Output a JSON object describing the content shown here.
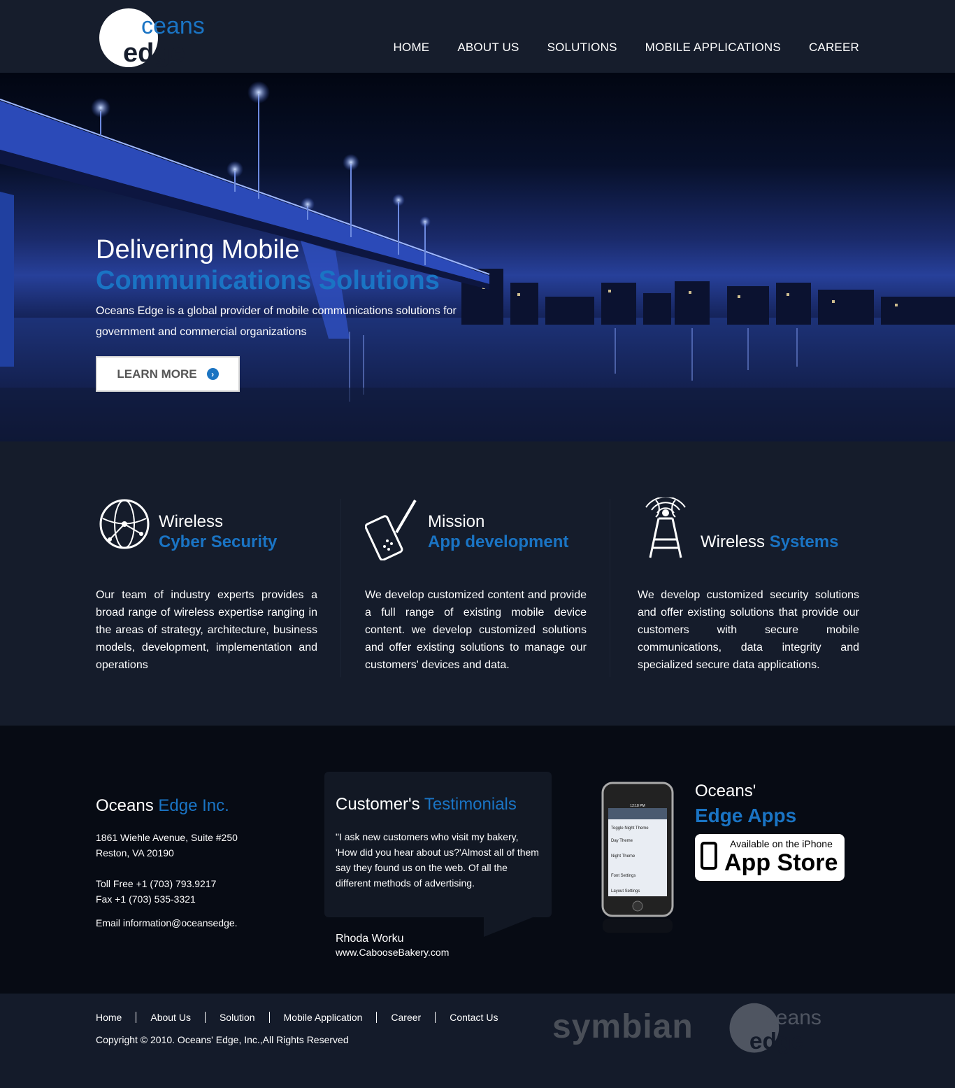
{
  "header": {
    "logo_text_top": "ceans",
    "logo_text_bottom": "edge",
    "nav": [
      "HOME",
      "ABOUT US",
      "SOLUTIONS",
      "MOBILE APPLICATIONS",
      "CAREER"
    ]
  },
  "hero": {
    "title_line1": "Delivering Mobile",
    "title_line2": "Communications Solutions",
    "description": "Oceans Edge is a global provider of mobile communications solutions for government and commercial organizations",
    "button_label": "LEARN MORE",
    "button_icon": "chevron-right-circle-icon"
  },
  "features": [
    {
      "title_white": "Wireless",
      "title_blue": "Cyber Security",
      "icon": "globe-network-icon",
      "text": "Our team of industry experts provides a broad range of wireless expertise ranging in the areas of strategy, architecture, business models, development, implementation and operations"
    },
    {
      "title_white": "Mission",
      "title_blue": "App development",
      "icon": "phone-pencil-icon",
      "text": "We develop customized content and provide a full range of existing mobile device content. we develop customized solutions and offer existing solutions to manage our customers' devices and data."
    },
    {
      "title_white": "Wireless",
      "title_blue": "Systems",
      "icon": "antenna-tower-icon",
      "text": "We develop customized security solutions and offer existing solutions that provide our customers with secure mobile communications, data integrity and specialized secure data applications."
    }
  ],
  "contact": {
    "title_white": "Oceans",
    "title_blue": "Edge Inc.",
    "address1": "1861 Wiehle Avenue, Suite #250",
    "address2": "Reston, VA 20190",
    "toll_free": "Toll Free +1 (703) 793.9217",
    "fax": "Fax +1 (703) 535-3321",
    "email": "Email information@oceansedge."
  },
  "testimonial": {
    "title_white": "Customer's",
    "title_blue": "Testimonials",
    "quote": "\"I ask new customers who visit my bakery, 'How did you hear about us?'Almost all of them say they found us on the web. Of all the different methods of advertising.",
    "author": "Rhoda Worku",
    "url": "www.CabooseBakery.com"
  },
  "apps": {
    "title1": "Oceans'",
    "title2": "Edge Apps",
    "badge_small": "Available on the iPhone",
    "badge_big": "App Store",
    "phone_screen_time": "12:18 PM",
    "phone_items": [
      "Toggle Night Theme",
      "Day Theme",
      "Night Theme",
      "Font Settings",
      "Layout Settings"
    ]
  },
  "bottom": {
    "links": [
      "Home",
      "About Us",
      "Solution",
      "Mobile Application",
      "Career",
      "Contact Us"
    ],
    "copyright": "Copyright © 2010. Oceans' Edge, Inc.,All Rights Reserved",
    "partner_logo": "symbian"
  },
  "colors": {
    "accent": "#1a74c4",
    "header_bg": "#161d2c",
    "footer_bg": "#070b14"
  }
}
